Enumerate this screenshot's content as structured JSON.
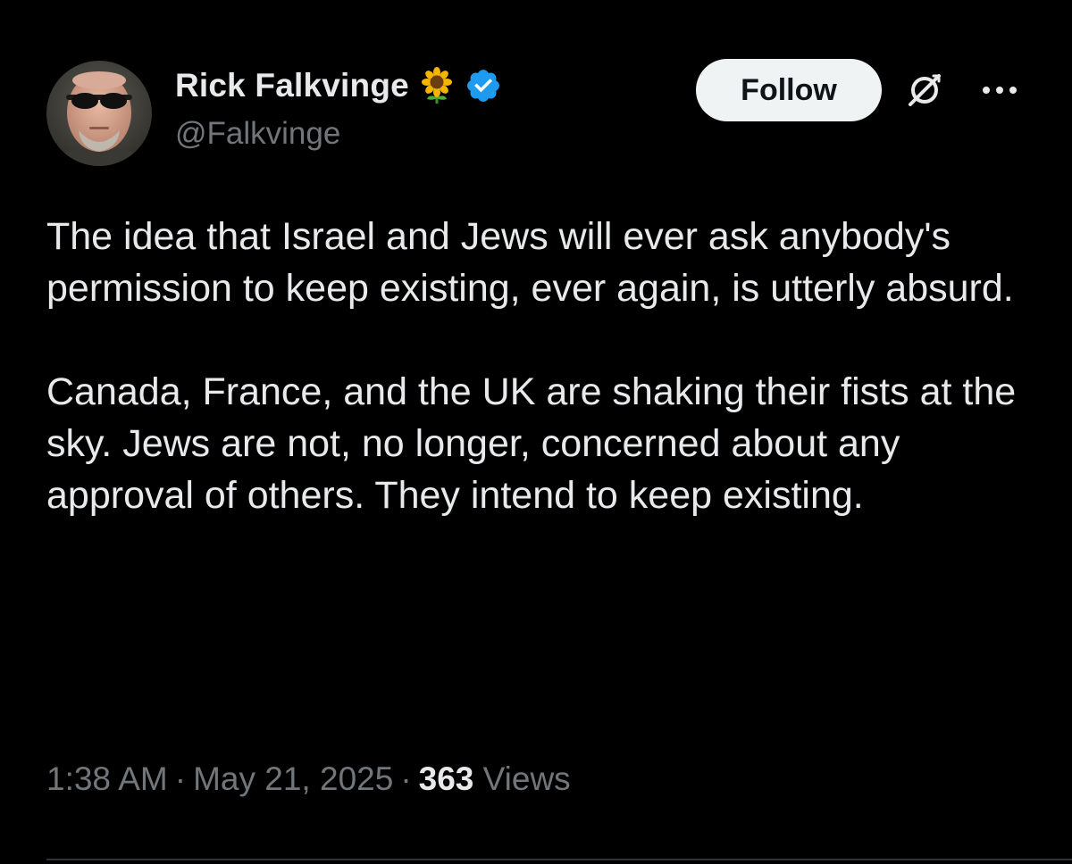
{
  "author": {
    "display_name": "Rick Falkvinge",
    "handle": "@Falkvinge",
    "name_emoji": "sunflower-icon",
    "verified": true
  },
  "actions": {
    "follow_label": "Follow",
    "grok_icon": "grok-icon",
    "more_icon": "more-icon"
  },
  "tweet": {
    "paragraphs": [
      "The idea that Israel and Jews will ever ask anybody's permission to keep existing, ever again, is utterly absurd.",
      "Canada, France, and the UK are shaking their fists at the sky. Jews are not, no longer, concerned about any approval of others. They intend to keep existing."
    ]
  },
  "meta": {
    "time": "1:38 AM",
    "date": "May 21, 2025",
    "views_count": "363",
    "views_label": "Views",
    "separator": "·"
  },
  "colors": {
    "background": "#000000",
    "text_primary": "#e7e9ea",
    "text_secondary": "#71767b",
    "follow_bg": "#eff3f4",
    "verified_blue": "#1d9bf0",
    "divider": "#2f3336"
  }
}
